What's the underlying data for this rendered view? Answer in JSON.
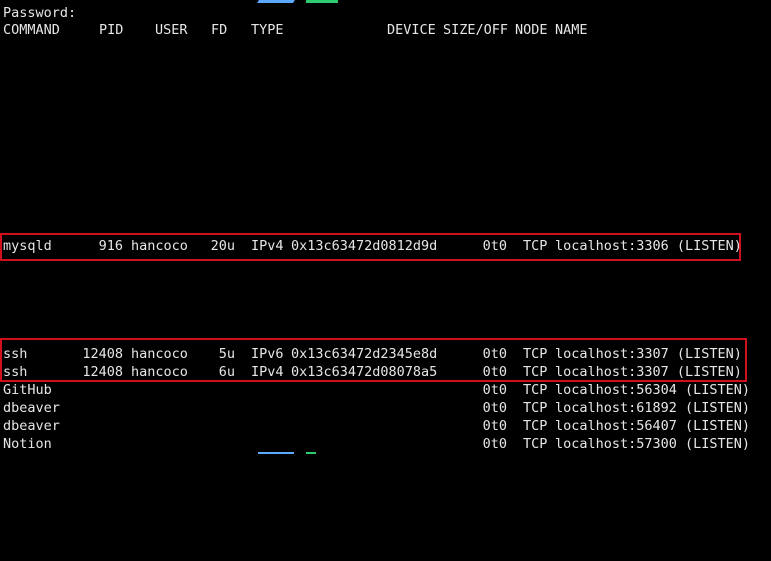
{
  "prompt": {
    "password_label": "Password:"
  },
  "header": {
    "command": "COMMAND",
    "pid": "PID",
    "user": "USER",
    "fd": "FD",
    "type": "TYPE",
    "device": "DEVICE",
    "size_off": "SIZE/OFF",
    "node": "NODE",
    "name": "NAME"
  },
  "rows": [
    {
      "command": "mysqld",
      "pid": "916",
      "user": "hancoco",
      "fd": "20u",
      "type": "IPv4",
      "device": "0x13c63472d0812d9d",
      "size_off": "0t0",
      "node": "TCP",
      "name": "localhost:3306 (LISTEN)"
    },
    {
      "command": "ssh",
      "pid": "12408",
      "user": "hancoco",
      "fd": "5u",
      "type": "IPv6",
      "device": "0x13c63472d2345e8d",
      "size_off": "0t0",
      "node": "TCP",
      "name": "localhost:3307 (LISTEN)"
    },
    {
      "command": "ssh",
      "pid": "12408",
      "user": "hancoco",
      "fd": "6u",
      "type": "IPv4",
      "device": "0x13c63472d08078a5",
      "size_off": "0t0",
      "node": "TCP",
      "name": "localhost:3307 (LISTEN)"
    },
    {
      "command": "GitHub",
      "pid": "",
      "user": "",
      "fd": "",
      "type": "",
      "device": "",
      "size_off": "0t0",
      "node": "TCP",
      "name": "localhost:56304 (LISTEN)"
    },
    {
      "command": "dbeaver",
      "pid": "",
      "user": "",
      "fd": "",
      "type": "",
      "device": "",
      "size_off": "0t0",
      "node": "TCP",
      "name": "localhost:61892 (LISTEN)"
    },
    {
      "command": "dbeaver",
      "pid": "",
      "user": "",
      "fd": "",
      "type": "",
      "device": "",
      "size_off": "0t0",
      "node": "TCP",
      "name": "localhost:56407 (LISTEN)"
    },
    {
      "command": "Notion",
      "pid": "",
      "user": "",
      "fd": "",
      "type": "",
      "device": "",
      "size_off": "0t0",
      "node": "TCP",
      "name": "localhost:57300 (LISTEN)"
    }
  ],
  "colors": {
    "highlight": "#d0101c",
    "background": "#000000",
    "text": "#e6e6e6"
  }
}
